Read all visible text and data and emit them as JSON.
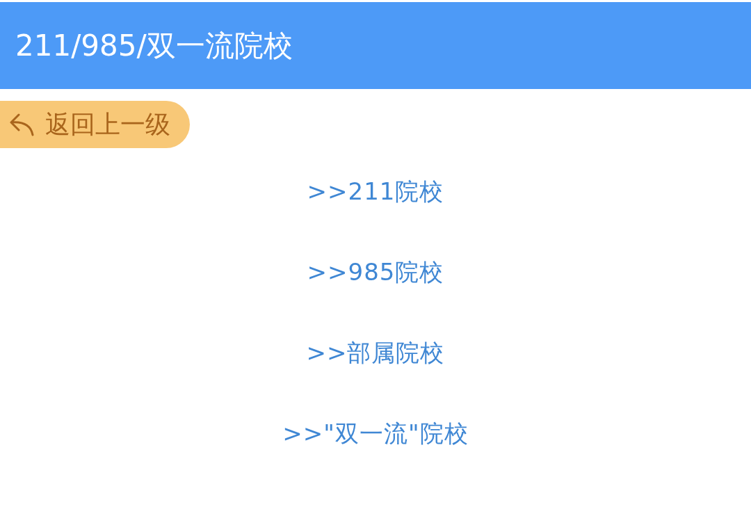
{
  "header": {
    "title": "211/985/双一流院校"
  },
  "back_button": {
    "label": "返回上一级"
  },
  "links": [
    {
      "label": ">>211院校"
    },
    {
      "label": ">>985院校"
    },
    {
      "label": ">>部属院校"
    },
    {
      "label": ">>\"双一流\"院校"
    }
  ]
}
